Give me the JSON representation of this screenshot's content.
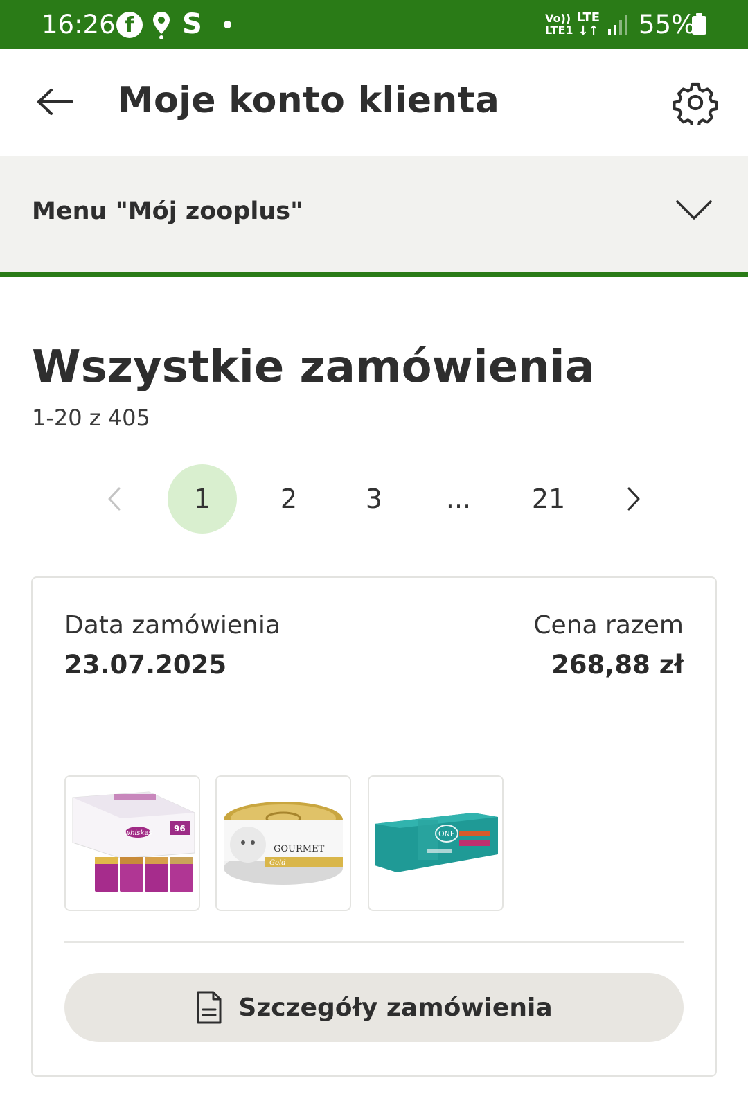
{
  "status_bar": {
    "time": "16:26",
    "notif_fb": "f",
    "notif_s": "S",
    "volte": "Vo))\nLTE1",
    "lte": "LTE\n↓↑",
    "battery": "55%"
  },
  "header": {
    "title": "Moje konto klienta",
    "back_icon": "arrow-left-icon",
    "settings_icon": "gear-icon"
  },
  "menu": {
    "label": "Menu \"Mój zooplus\"",
    "chevron_icon": "chevron-down-icon"
  },
  "orders": {
    "title": "Wszystkie zamówienia",
    "count": "1-20 z 405"
  },
  "pagination": {
    "prev": "‹",
    "pages": [
      "1",
      "2",
      "3",
      "...",
      "21"
    ],
    "active": "1",
    "next": "›"
  },
  "order_card": {
    "date_label": "Data zamówienia",
    "date_value": "23.07.2025",
    "price_label": "Cena razem",
    "price_value": "268,88 zł",
    "products": [
      {
        "brand": "whiskas",
        "badge": "96"
      },
      {
        "brand": "GOURMET",
        "sub": "Gold"
      },
      {
        "brand": "ONE"
      }
    ],
    "details_button": "Szczegóły zamówienia",
    "details_icon": "document-icon"
  },
  "colors": {
    "brand_green": "#2a7b17",
    "active_page_bg": "#d9efcf",
    "menu_bg": "#f2f2ef",
    "button_bg": "#e8e6e1"
  }
}
